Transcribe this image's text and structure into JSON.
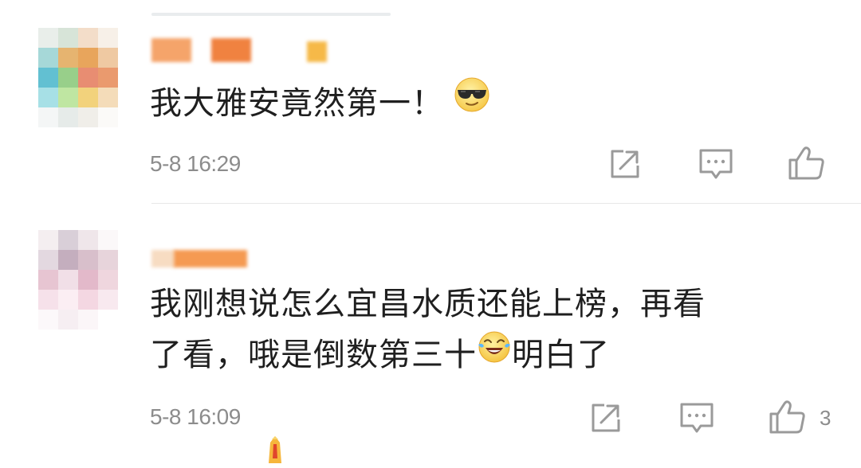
{
  "comments": [
    {
      "text": "我大雅安竟然第一！",
      "emoji": "sunglasses-face",
      "time": "5-8 16:29",
      "like_count": ""
    },
    {
      "text_line1": "我刚想说怎么宜昌水质还能上榜，再看",
      "text_line2a": "了看，哦是倒数第三十",
      "emoji": "laughing-crying-face",
      "text_line2b": "明白了",
      "time": "5-8 16:09",
      "like_count": "3"
    }
  ],
  "colors": {
    "text": "#1f1f1f",
    "meta": "#8c8c8c",
    "icon": "#9a9a9a",
    "divider": "#e8e8e8"
  }
}
